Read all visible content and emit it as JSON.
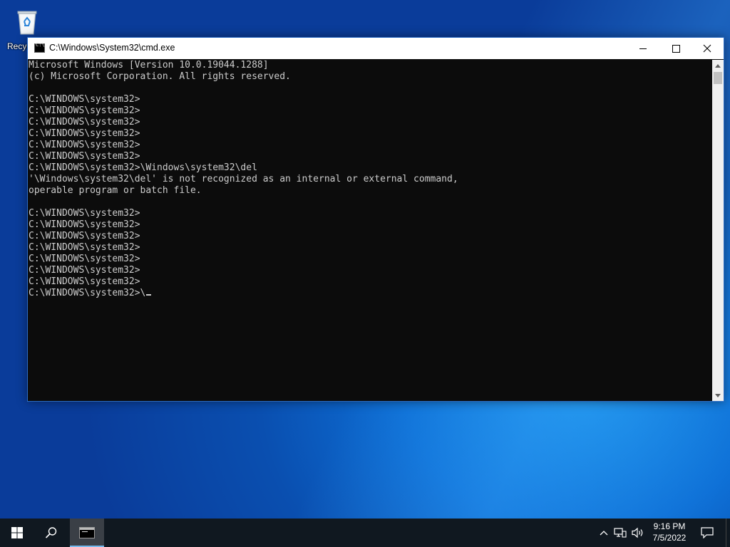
{
  "desktop": {
    "icons": [
      {
        "label": "Recyc",
        "icon": "recycle-bin-icon"
      }
    ]
  },
  "window": {
    "title": "C:\\Windows\\System32\\cmd.exe",
    "icon": "cmd-icon",
    "controls": {
      "minimize": "minimize-icon",
      "maximize": "maximize-icon",
      "close": "close-icon"
    },
    "console_text": "Microsoft Windows [Version 10.0.19044.1288]\n(c) Microsoft Corporation. All rights reserved.\n\nC:\\WINDOWS\\system32>\nC:\\WINDOWS\\system32>\nC:\\WINDOWS\\system32>\nC:\\WINDOWS\\system32>\nC:\\WINDOWS\\system32>\nC:\\WINDOWS\\system32>\nC:\\WINDOWS\\system32>\\Windows\\system32\\del\n'\\Windows\\system32\\del' is not recognized as an internal or external command,\noperable program or batch file.\n\nC:\\WINDOWS\\system32>\nC:\\WINDOWS\\system32>\nC:\\WINDOWS\\system32>\nC:\\WINDOWS\\system32>\nC:\\WINDOWS\\system32>\nC:\\WINDOWS\\system32>\nC:\\WINDOWS\\system32>\nC:\\WINDOWS\\system32>\\",
    "colors": {
      "background": "#0c0c0c",
      "foreground": "#cccccc"
    }
  },
  "taskbar": {
    "start_icon": "windows-logo-icon",
    "search_icon": "search-icon",
    "apps": [
      {
        "icon": "cmd-icon",
        "active": true
      }
    ],
    "tray": {
      "chevron_icon": "chevron-up-icon",
      "network_icon": "network-icon",
      "volume_icon": "volume-icon",
      "time": "9:16 PM",
      "date": "7/5/2022",
      "notification_icon": "notification-icon"
    }
  }
}
